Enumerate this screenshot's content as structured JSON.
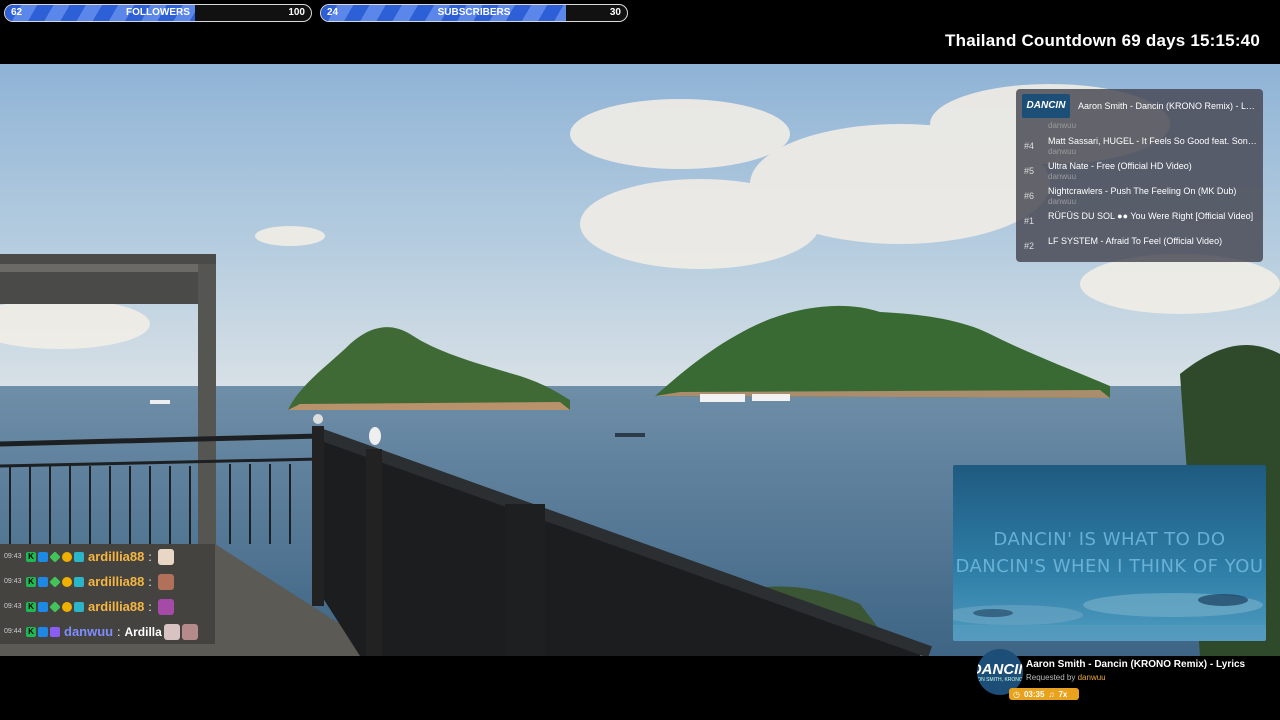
{
  "goals": {
    "followers": {
      "current": "62",
      "target": "100",
      "label": "FOLLOWERS",
      "progress": 0.62
    },
    "subscribers": {
      "current": "24",
      "target": "30",
      "label": "SUBSCRIBERS",
      "progress": 0.8
    }
  },
  "countdown": {
    "text": "Thailand Countdown 69 days 15:15:40"
  },
  "queue": {
    "thumb_title": "DANCIN",
    "now_playing": "Aaron Smith - Dancin (KRONO Remix) - Lyrics",
    "items": [
      {
        "num": "",
        "title": "",
        "requester": "danwuu"
      },
      {
        "num": "#4",
        "title": "Matt Sassari, HUGEL - It Feels So Good feat. Sonique",
        "requester": "danwuu"
      },
      {
        "num": "#5",
        "title": "Ultra Nate - Free (Official HD Video)",
        "requester": "danwuu"
      },
      {
        "num": "#6",
        "title": "Nightcrawlers - Push The Feeling On (MK Dub)",
        "requester": "danwuu"
      },
      {
        "num": "#1",
        "title": "RÜFÜS DU SOL ●● You Were Right [Official Video]",
        "requester": ""
      },
      {
        "num": "#2",
        "title": "LF SYSTEM - Afraid To Feel (Official Video)",
        "requester": ""
      }
    ]
  },
  "chat": [
    {
      "time": "09:43",
      "user": "ardillia88",
      "user_color": "#f5b642",
      "message": ""
    },
    {
      "time": "09:43",
      "user": "ardillia88",
      "user_color": "#f5b642",
      "message": ""
    },
    {
      "time": "09:43",
      "user": "ardillia88",
      "user_color": "#f5b642",
      "message": ""
    },
    {
      "time": "09:44",
      "user": "danwuu",
      "user_color": "#7f8cff",
      "message": "Ardilla"
    }
  ],
  "video": {
    "lyric_line1": "DANCIN' IS WHAT TO DO",
    "lyric_line2": "DANCIN'S WHEN I THINK OF YOU"
  },
  "now_playing": {
    "avatar_text": "DANCIN",
    "avatar_sub": "ON SMITH, KRONO",
    "title": "Aaron Smith - Dancin (KRONO Remix) - Lyrics",
    "requested_prefix": "Requested by",
    "requested_by": "danwuu",
    "time": "03:35",
    "queue_count": "7x"
  },
  "colors": {
    "goal_fill": "#2d5fd6",
    "accent": "#e8a21e",
    "panel": "#46464f"
  }
}
